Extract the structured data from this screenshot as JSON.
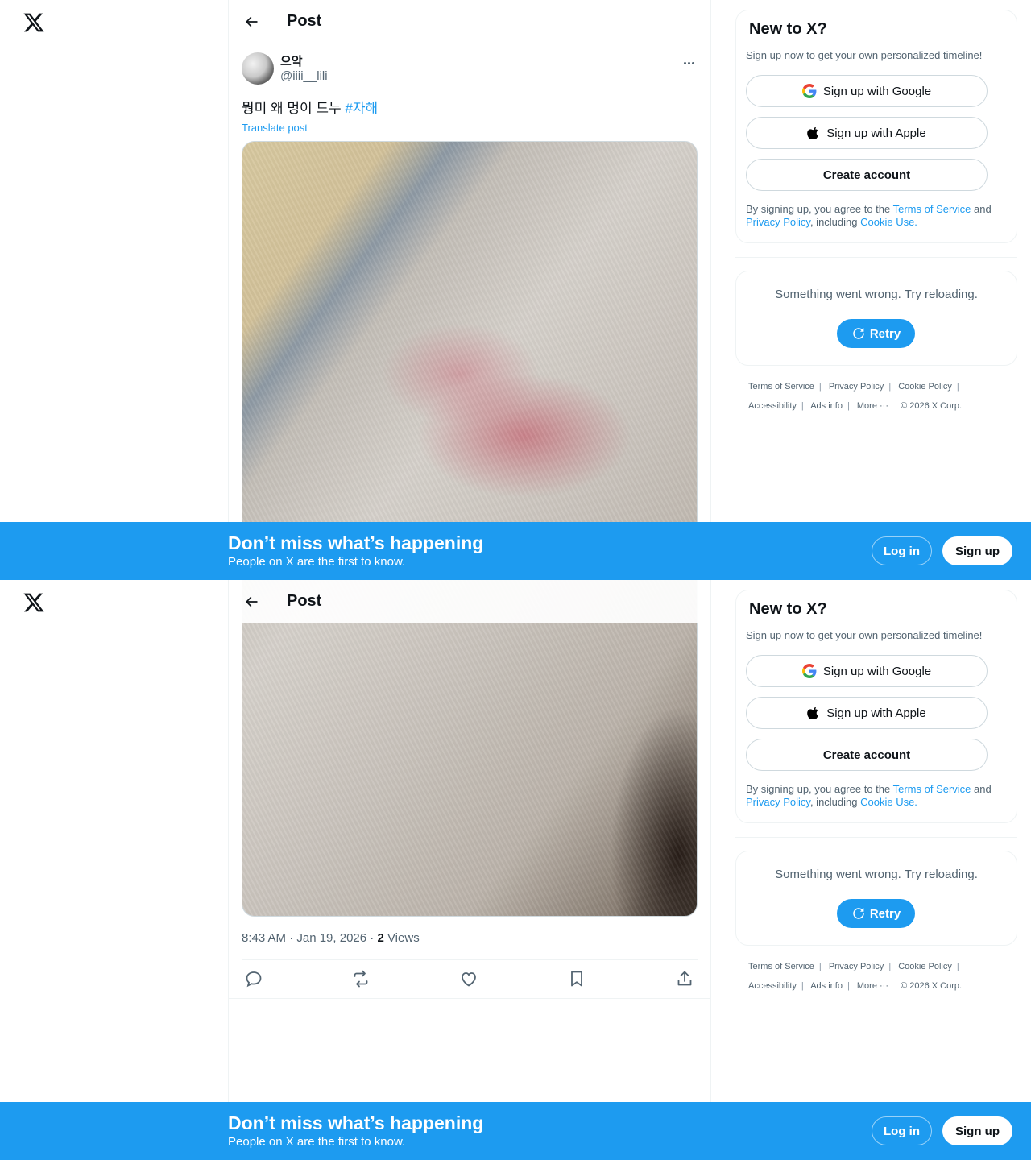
{
  "header": {
    "title": "Post"
  },
  "post": {
    "display_name": "으악",
    "handle": "@iiii__lili",
    "text": "뭥미 왜 멍이 드누",
    "hashtag": "#자해",
    "translate": "Translate post",
    "time": "8:43 AM · Jan 19, 2026 · ",
    "views_count": "2",
    "views_label": " Views"
  },
  "signup_card": {
    "title": "New to X?",
    "subtitle": "Sign up now to get your own personalized timeline!",
    "google": "Sign up with Google",
    "apple": "Sign up with Apple",
    "create": "Create account",
    "terms_prefix": "By signing up, you agree to the ",
    "terms_link": "Terms of Service",
    "terms_and": " and ",
    "privacy_link": "Privacy Policy",
    "including": ", including ",
    "cookie_link": "Cookie Use."
  },
  "error_card": {
    "message": "Something went wrong. Try reloading.",
    "retry": "Retry"
  },
  "footer": {
    "terms": "Terms of Service",
    "privacy": "Privacy Policy",
    "cookie": "Cookie Policy",
    "accessibility": "Accessibility",
    "ads": "Ads info",
    "more": "More ···",
    "copyright": "© 2026 X Corp."
  },
  "banner": {
    "title": "Don’t miss what’s happening",
    "subtitle": "People on X are the first to know.",
    "login": "Log in",
    "signup": "Sign up"
  },
  "colors": {
    "accent": "#1d9bf0",
    "text": "#0f1419",
    "muted": "#536471"
  }
}
